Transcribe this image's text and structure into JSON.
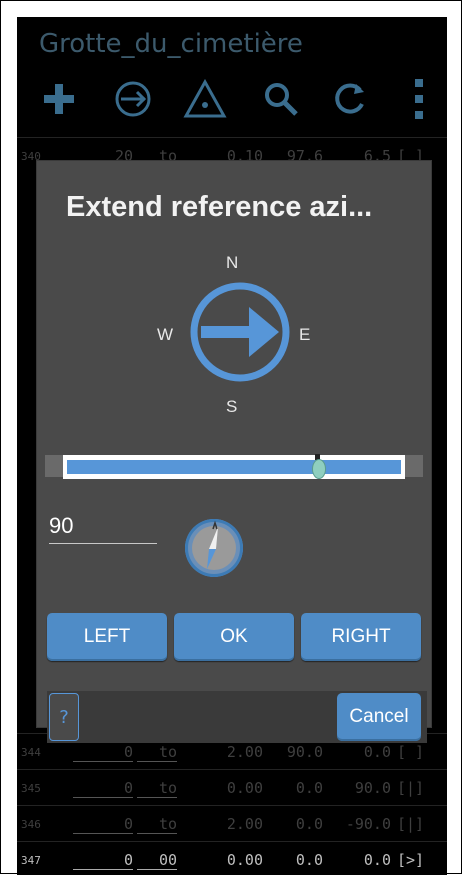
{
  "app": {
    "title": "Grotte_du_cimetière"
  },
  "toolbar": {
    "icons": [
      "add-icon",
      "minus-circle-icon",
      "triangle-icon",
      "search-icon",
      "refresh-icon",
      "menu-icon"
    ]
  },
  "rows": [
    {
      "id": "340",
      "from": "20",
      "to": "to",
      "c1": "0.10",
      "c2": "97.6",
      "c3": "6.5",
      "flag": "[ ]"
    },
    {
      "id": "344",
      "from": "0",
      "to": "to",
      "c1": "2.00",
      "c2": "90.0",
      "c3": "0.0",
      "flag": "[ ]"
    },
    {
      "id": "345",
      "from": "0",
      "to": "to",
      "c1": "0.00",
      "c2": "0.0",
      "c3": "90.0",
      "flag": "[|]"
    },
    {
      "id": "346",
      "from": "0",
      "to": "to",
      "c1": "2.00",
      "c2": "0.0",
      "c3": "-90.0",
      "flag": "[|]"
    },
    {
      "id": "347",
      "from": "0",
      "to": "00",
      "c1": "0.00",
      "c2": "0.0",
      "c3": "0.0",
      "flag": "[>]"
    }
  ],
  "dialog": {
    "title": "Extend reference azi...",
    "compass": {
      "n": "N",
      "e": "E",
      "s": "S",
      "w": "W"
    },
    "slider": {
      "value_fraction": 0.75
    },
    "azimuth_value": "90",
    "buttons": {
      "left": "LEFT",
      "ok": "OK",
      "right": "RIGHT"
    },
    "help": "?",
    "cancel": "Cancel"
  },
  "colors": {
    "accent": "#5796d8",
    "dialog_bg": "#4a4a4a",
    "screen_bg": "#000000"
  }
}
